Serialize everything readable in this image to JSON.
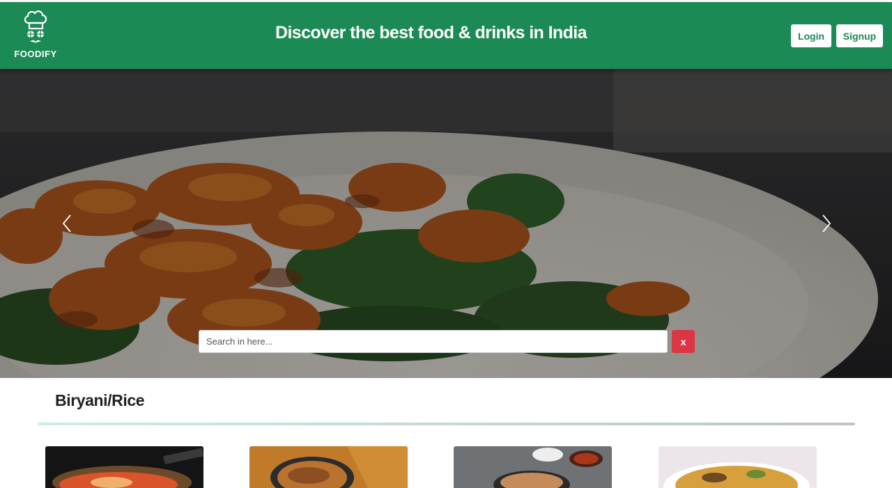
{
  "brand": {
    "name": "FOODIFY",
    "logo_icon": "chef-hat-icon"
  },
  "header": {
    "tagline": "Discover the best food & drinks in India",
    "login_label": "Login",
    "signup_label": "Signup"
  },
  "hero": {
    "prev_icon": "chevron-left-icon",
    "next_icon": "chevron-right-icon",
    "search": {
      "placeholder": "Search in here...",
      "value": ""
    },
    "clear_label": "x"
  },
  "section": {
    "title": "Biryani/Rice",
    "items": [
      {
        "image": "food-image-1"
      },
      {
        "image": "food-image-2"
      },
      {
        "image": "food-image-3"
      },
      {
        "image": "food-image-4"
      }
    ]
  },
  "colors": {
    "brand_green": "#1c8a55",
    "clear_red": "#dc3545"
  }
}
